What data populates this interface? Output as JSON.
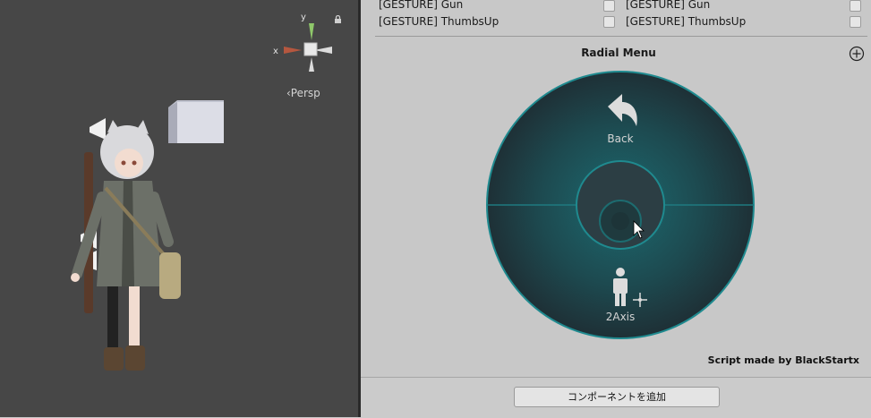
{
  "scene": {
    "persp_label": "‹Persp",
    "gizmo_labels": {
      "y": "y",
      "x": "x"
    },
    "icons": [
      "lock-icon",
      "orientation-gizmo",
      "cube-object",
      "audio-source-gizmo",
      "avatar-character"
    ]
  },
  "inspector": {
    "gesture_rows": [
      {
        "left": "[GESTURE] Gun",
        "right": "[GESTURE] Gun"
      },
      {
        "left": "[GESTURE] ThumbsUp",
        "right": "[GESTURE] ThumbsUp"
      }
    ],
    "radial_menu": {
      "title": "Radial Menu",
      "items": [
        {
          "label": "Back",
          "icon": "back-arrow-icon"
        },
        {
          "label": "2Axis",
          "icon": "two-axis-puppet-icon"
        }
      ],
      "colors": {
        "outer": "#1f3a3f",
        "ring": "#1f8a8f",
        "inner": "#2c3e44"
      }
    },
    "script_credit": "Script made by BlackStartx",
    "add_component_label": "コンポーネントを追加"
  }
}
